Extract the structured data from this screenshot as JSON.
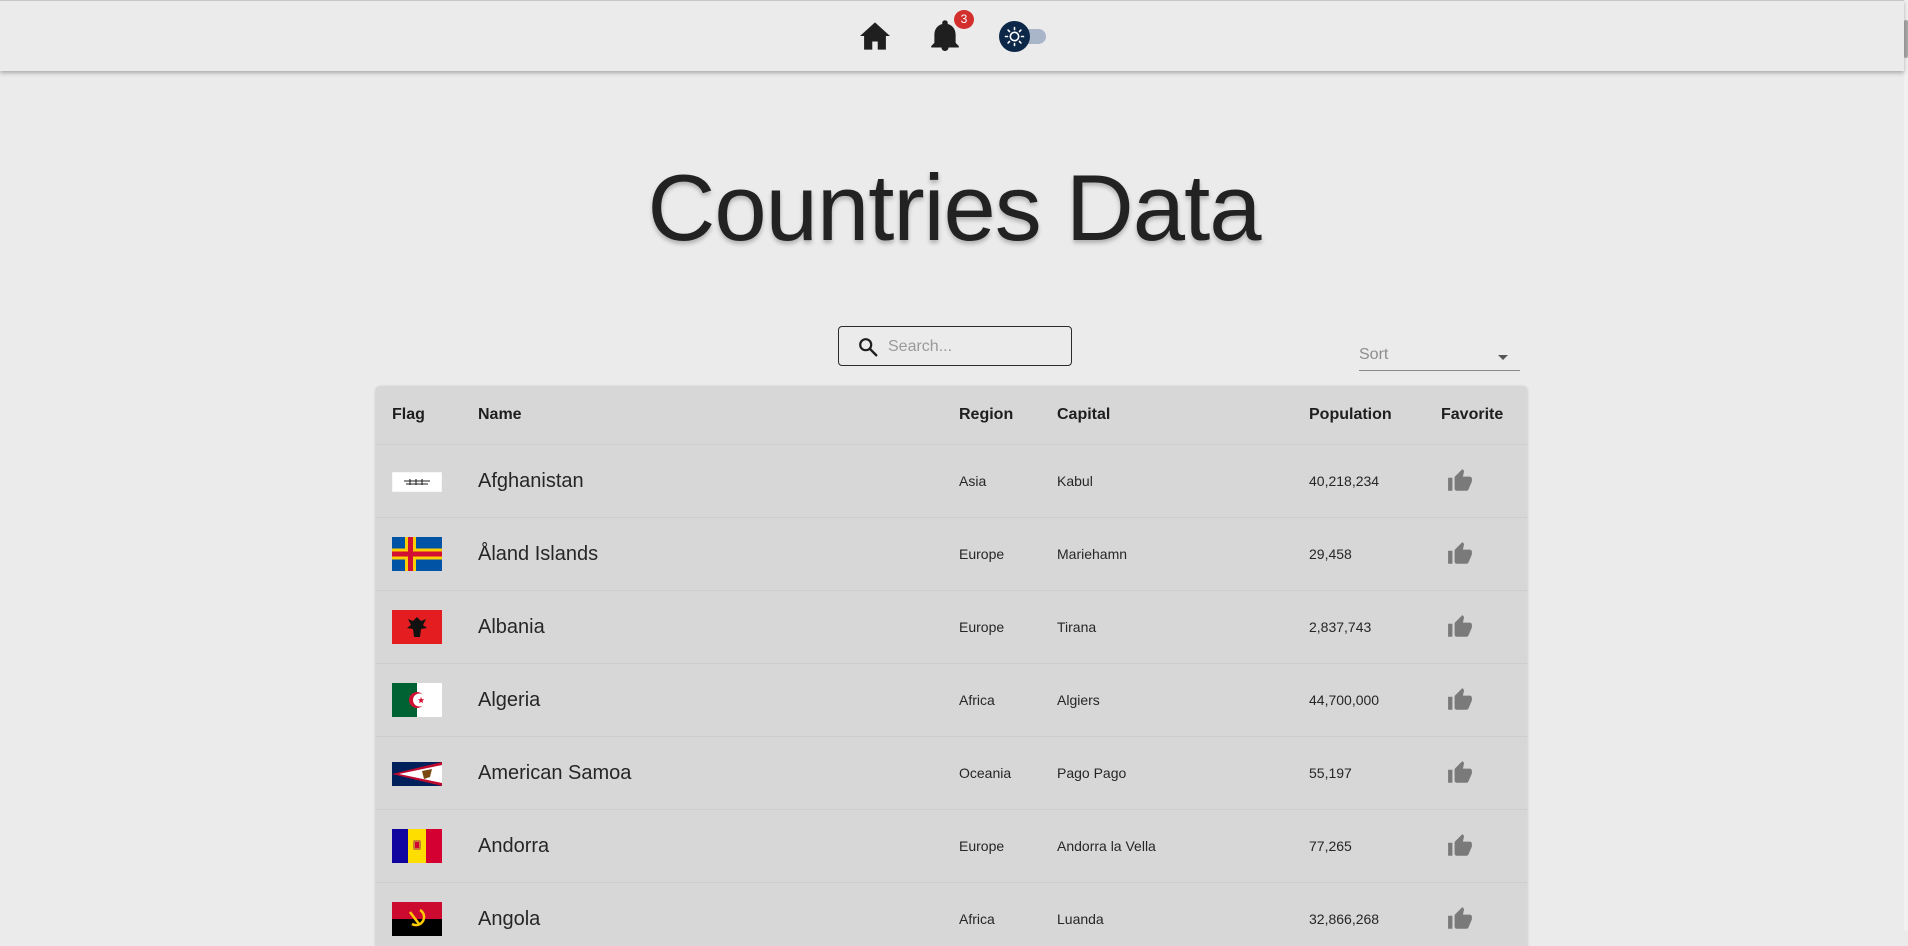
{
  "header": {
    "notification_count": "3"
  },
  "page": {
    "title": "Countries Data"
  },
  "search": {
    "placeholder": "Search..."
  },
  "sort": {
    "label": "Sort"
  },
  "table": {
    "columns": {
      "flag": "Flag",
      "name": "Name",
      "region": "Region",
      "capital": "Capital",
      "population": "Population",
      "favorite": "Favorite"
    },
    "rows": [
      {
        "name": "Afghanistan",
        "region": "Asia",
        "capital": "Kabul",
        "population": "40,218,234",
        "flag": "afghanistan-flag"
      },
      {
        "name": "Åland Islands",
        "region": "Europe",
        "capital": "Mariehamn",
        "population": "29,458",
        "flag": "aland-islands-flag"
      },
      {
        "name": "Albania",
        "region": "Europe",
        "capital": "Tirana",
        "population": "2,837,743",
        "flag": "albania-flag"
      },
      {
        "name": "Algeria",
        "region": "Africa",
        "capital": "Algiers",
        "population": "44,700,000",
        "flag": "algeria-flag"
      },
      {
        "name": "American Samoa",
        "region": "Oceania",
        "capital": "Pago Pago",
        "population": "55,197",
        "flag": "american-samoa-flag"
      },
      {
        "name": "Andorra",
        "region": "Europe",
        "capital": "Andorra la Vella",
        "population": "77,265",
        "flag": "andorra-flag"
      },
      {
        "name": "Angola",
        "region": "Africa",
        "capital": "Luanda",
        "population": "32,866,268",
        "flag": "angola-flag"
      }
    ]
  },
  "colors": {
    "background": "#ebebeb",
    "table_background": "#d7d7d7",
    "badge": "#d32f2f",
    "toggle_thumb": "#0d2748",
    "toggle_track": "#a9b6c9"
  },
  "icons": {
    "home": "home-icon",
    "notifications": "bell-icon",
    "theme": "sun-icon",
    "search": "search-icon",
    "favorite": "thumb-up-icon",
    "sort": "caret-down-icon"
  }
}
